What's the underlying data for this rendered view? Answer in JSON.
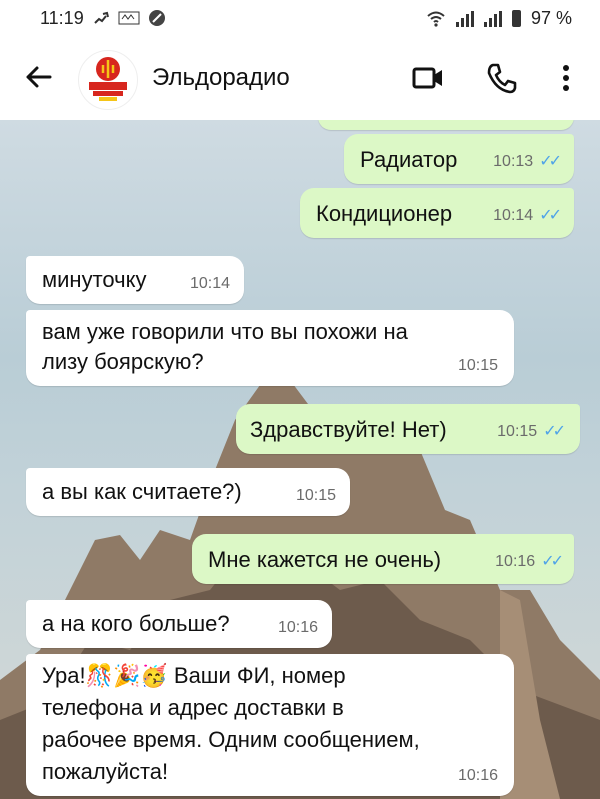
{
  "status_bar": {
    "time": "11:19",
    "battery": "97 %"
  },
  "header": {
    "title": "Эльдорадио",
    "avatar_logo_text": "эльдо РАДИО 101.4",
    "accent": "#d7261e"
  },
  "messages": [
    {
      "dir": "out",
      "text": "Радиатор",
      "time": "10:13",
      "read": true
    },
    {
      "dir": "out",
      "text": "Кондиционер",
      "time": "10:14",
      "read": true
    },
    {
      "dir": "in",
      "text": "минуточку",
      "time": "10:14"
    },
    {
      "dir": "in",
      "line1": "вам уже говорили что вы похожи на",
      "line2": "лизу боярскую?",
      "time": "10:15"
    },
    {
      "dir": "out",
      "text": "Здравствуйте! Нет)",
      "time": "10:15",
      "read": true
    },
    {
      "dir": "in",
      "text": "а вы как считаете?)",
      "time": "10:15"
    },
    {
      "dir": "out",
      "text": "Мне кажется не очень)",
      "time": "10:16",
      "read": true
    },
    {
      "dir": "in",
      "text": "а на кого больше?",
      "time": "10:16"
    },
    {
      "dir": "in",
      "line1_prefix": "Ура!",
      "emojis": "🎊🎉🥳",
      "line1_suffix": "Ваши ФИ, номер",
      "line2": "телефона и адрес доставки в",
      "line3": "рабочее время. Одним сообщением,",
      "line4": "пожалуйста!",
      "time": "10:16"
    }
  ],
  "colors": {
    "outgoing_bubble": "#dcf8c6",
    "incoming_bubble": "#ffffff",
    "read_ticks": "#4fa3e8"
  }
}
